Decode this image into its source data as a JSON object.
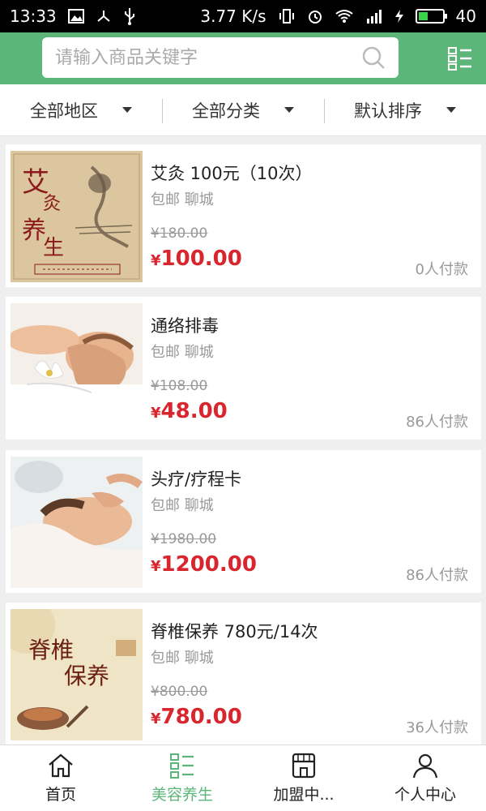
{
  "status_bar": {
    "time": "13:33",
    "speed": "3.77 K/s",
    "battery": "40",
    "battery_level": 0.4
  },
  "header": {
    "search_placeholder": "请输入商品关键字"
  },
  "filters": [
    {
      "label": "全部地区"
    },
    {
      "label": "全部分类"
    },
    {
      "label": "默认排序"
    }
  ],
  "products": [
    {
      "title": "艾灸 100元（10次）",
      "subtitle": "包邮 聊城",
      "old_price": "¥180.00",
      "price_symbol": "¥",
      "price": "100.00",
      "paid": "0人付款",
      "image": "moxibustion-art"
    },
    {
      "title": "通络排毒",
      "subtitle": "包邮 聊城",
      "old_price": "¥108.00",
      "price_symbol": "¥",
      "price": "48.00",
      "paid": "86人付款",
      "image": "spa-back-massage"
    },
    {
      "title": "头疗/疗程卡",
      "subtitle": "包邮 聊城",
      "old_price": "¥1980.00",
      "price_symbol": "¥",
      "price": "1200.00",
      "paid": "86人付款",
      "image": "head-massage"
    },
    {
      "title": "脊椎保养 780元/14次",
      "subtitle": "包邮 聊城",
      "old_price": "¥800.00",
      "price_symbol": "¥",
      "price": "780.00",
      "paid": "36人付款",
      "image": "spine-care-art"
    }
  ],
  "tabs": [
    {
      "label": "首页",
      "icon": "home-icon",
      "active": false
    },
    {
      "label": "美容养生",
      "icon": "list-icon",
      "active": true
    },
    {
      "label": "加盟中...",
      "icon": "store-icon",
      "active": false
    },
    {
      "label": "个人中心",
      "icon": "person-icon",
      "active": false
    }
  ],
  "colors": {
    "brand_green": "#5cb579",
    "price_red": "#d9262e"
  }
}
